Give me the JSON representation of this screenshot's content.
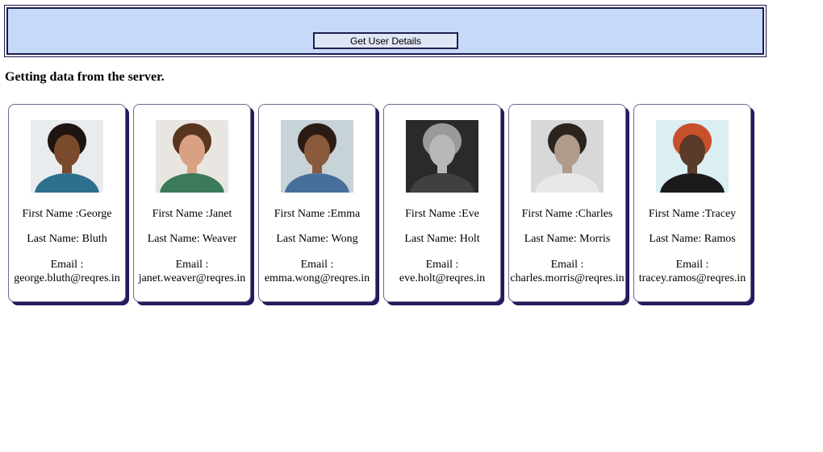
{
  "toolbar": {
    "button_label": "Get User Details"
  },
  "status_text": "Getting data from the server.",
  "users": [
    {
      "first_name": "First Name :George",
      "last_name": "Last Name: Bluth",
      "email_label": "Email :",
      "email": "george.bluth@reqres.in",
      "photo_bg": "#e8ecef",
      "photo_skin": "#7a4a2c",
      "photo_hair": "#1e1410",
      "photo_shirt": "#2e6f8e"
    },
    {
      "first_name": "First Name :Janet",
      "last_name": "Last Name: Weaver",
      "email_label": "Email :",
      "email": "janet.weaver@reqres.in",
      "photo_bg": "#e9e6e1",
      "photo_skin": "#d9a184",
      "photo_hair": "#5a3520",
      "photo_shirt": "#3b7a5a"
    },
    {
      "first_name": "First Name :Emma",
      "last_name": "Last Name: Wong",
      "email_label": "Email :",
      "email": "emma.wong@reqres.in",
      "photo_bg": "#c8d3d8",
      "photo_skin": "#8a5a3c",
      "photo_hair": "#2a1c14",
      "photo_shirt": "#466f9c"
    },
    {
      "first_name": "First Name :Eve",
      "last_name": "Last Name: Holt",
      "email_label": "Email :",
      "email": "eve.holt@reqres.in",
      "photo_bg": "#2a2a2a",
      "photo_skin": "#b8b8b8",
      "photo_hair": "#9a9a9a",
      "photo_shirt": "#404040"
    },
    {
      "first_name": "First Name :Charles",
      "last_name": "Last Name: Morris",
      "email_label": "Email :",
      "email": "charles.morris@reqres.in",
      "photo_bg": "#d8d8d8",
      "photo_skin": "#b09a8c",
      "photo_hair": "#2a2420",
      "photo_shirt": "#e8e8e8"
    },
    {
      "first_name": "First Name :Tracey",
      "last_name": "Last Name: Ramos",
      "email_label": "Email :",
      "email": "tracey.ramos@reqres.in",
      "photo_bg": "#dbeef2",
      "photo_skin": "#5a3a28",
      "photo_hair": "#c8502a",
      "photo_shirt": "#1a1a1a"
    }
  ]
}
